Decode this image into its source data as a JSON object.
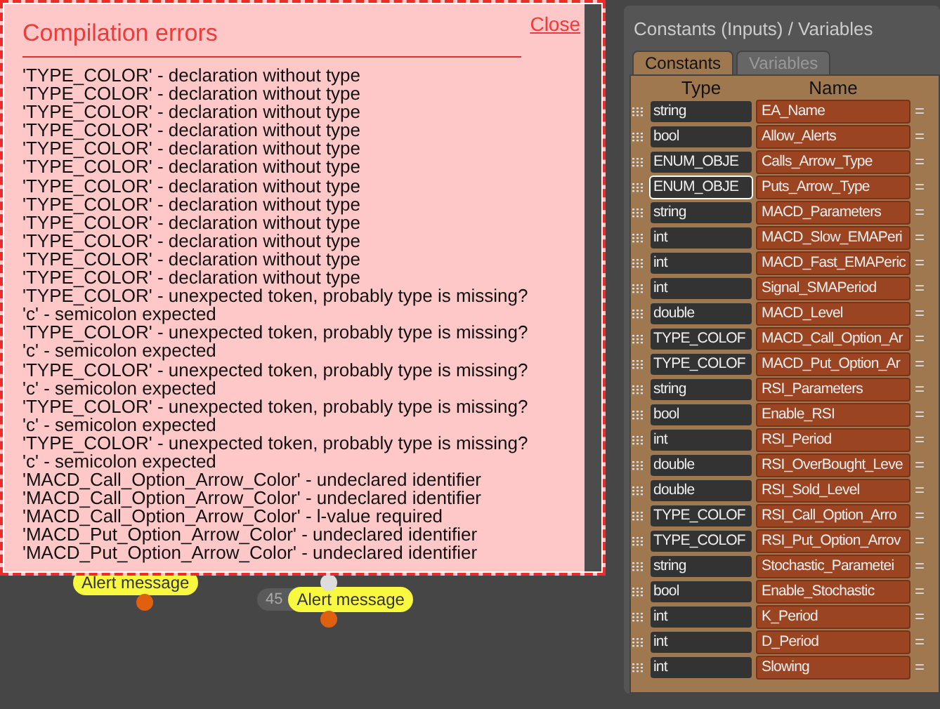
{
  "dialog": {
    "title": "Compilation errors",
    "close": "Close",
    "messages": [
      "'TYPE_COLOR' - declaration without type",
      "'TYPE_COLOR' - declaration without type",
      "'TYPE_COLOR' - declaration without type",
      "'TYPE_COLOR' - declaration without type",
      "'TYPE_COLOR' - declaration without type",
      "'TYPE_COLOR' - declaration without type",
      "'TYPE_COLOR' - declaration without type",
      "'TYPE_COLOR' - declaration without type",
      "'TYPE_COLOR' - declaration without type",
      "'TYPE_COLOR' - declaration without type",
      "'TYPE_COLOR' - declaration without type",
      "'TYPE_COLOR' - declaration without type",
      "'TYPE_COLOR' - unexpected token, probably type is missing?",
      "'c' - semicolon expected",
      "'TYPE_COLOR' - unexpected token, probably type is missing?",
      "'c' - semicolon expected",
      "'TYPE_COLOR' - unexpected token, probably type is missing?",
      "'c' - semicolon expected",
      "'TYPE_COLOR' - unexpected token, probably type is missing?",
      "'c' - semicolon expected",
      "'TYPE_COLOR' - unexpected token, probably type is missing?",
      "'c' - semicolon expected",
      "'MACD_Call_Option_Arrow_Color' - undeclared identifier",
      "'MACD_Call_Option_Arrow_Color' - undeclared identifier",
      "'MACD_Call_Option_Arrow_Color' - l-value required",
      "'MACD_Put_Option_Arrow_Color' - undeclared identifier",
      "'MACD_Put_Option_Arrow_Color' - undeclared identifier"
    ]
  },
  "nodes": [
    {
      "label": "Alert message"
    },
    {
      "number": "45",
      "label": "Alert message"
    }
  ],
  "panel": {
    "title": "Constants (Inputs) / Variables",
    "tabs": [
      {
        "label": "Constants",
        "selected": true
      },
      {
        "label": "Variables",
        "selected": false
      }
    ],
    "columns": [
      "Type",
      "Name"
    ],
    "rows": [
      {
        "type": "string",
        "name": "EA_Name",
        "focused": false
      },
      {
        "type": "bool",
        "name": "Allow_Alerts",
        "focused": false
      },
      {
        "type": "ENUM_OBJE",
        "name": "Calls_Arrow_Type",
        "focused": false
      },
      {
        "type": "ENUM_OBJE",
        "name": "Puts_Arrow_Type",
        "focused": true
      },
      {
        "type": "string",
        "name": "MACD_Parameters",
        "focused": false
      },
      {
        "type": "int",
        "name": "MACD_Slow_EMAPeri",
        "focused": false
      },
      {
        "type": "int",
        "name": "MACD_Fast_EMAPeric",
        "focused": false
      },
      {
        "type": "int",
        "name": "Signal_SMAPeriod",
        "focused": false
      },
      {
        "type": "double",
        "name": "MACD_Level",
        "focused": false
      },
      {
        "type": "TYPE_COLOF",
        "name": "MACD_Call_Option_Ar",
        "focused": false
      },
      {
        "type": "TYPE_COLOF",
        "name": "MACD_Put_Option_Ar",
        "focused": false
      },
      {
        "type": "string",
        "name": "RSI_Parameters",
        "focused": false
      },
      {
        "type": "bool",
        "name": "Enable_RSI",
        "focused": false
      },
      {
        "type": "int",
        "name": "RSI_Period",
        "focused": false
      },
      {
        "type": "double",
        "name": "RSI_OverBought_Leve",
        "focused": false
      },
      {
        "type": "double",
        "name": "RSI_Sold_Level",
        "focused": false
      },
      {
        "type": "TYPE_COLOF",
        "name": "RSI_Call_Option_Arro",
        "focused": false
      },
      {
        "type": "TYPE_COLOF",
        "name": "RSI_Put_Option_Arrov",
        "focused": false
      },
      {
        "type": "string",
        "name": "Stochastic_Parametei",
        "focused": false
      },
      {
        "type": "bool",
        "name": "Enable_Stochastic",
        "focused": false
      },
      {
        "type": "int",
        "name": "K_Period",
        "focused": false
      },
      {
        "type": "int",
        "name": "D_Period",
        "focused": false
      },
      {
        "type": "int",
        "name": "Slowing",
        "focused": false
      }
    ],
    "equals": "="
  }
}
